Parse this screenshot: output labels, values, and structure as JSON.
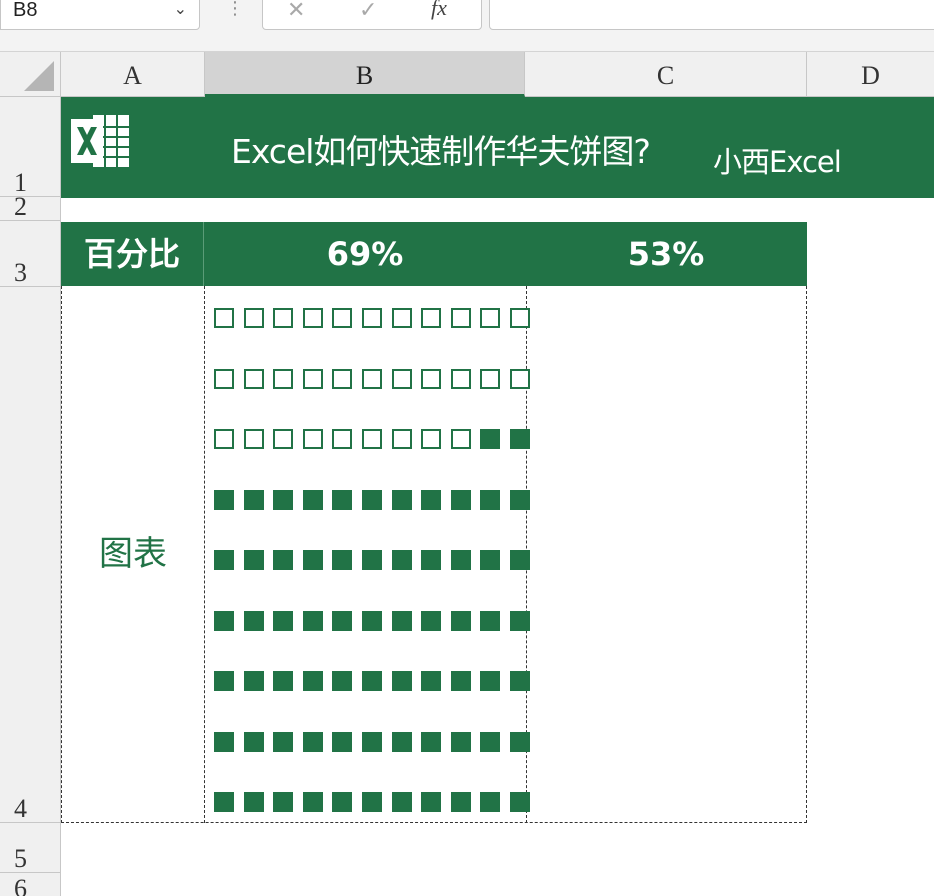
{
  "formula_bar": {
    "name_box": "B8",
    "name_box_arrow": "⌄",
    "separator": "⋮",
    "cancel_icon": "✕",
    "enter_icon": "✓",
    "fx_label": "fx"
  },
  "columns": [
    "A",
    "B",
    "C",
    "D"
  ],
  "rows": [
    "1",
    "2",
    "3",
    "4",
    "5",
    "6"
  ],
  "title_banner": {
    "title": "Excel如何快速制作华夫饼图?",
    "brand": "小西Excel",
    "logo": "excel-logo-icon"
  },
  "table": {
    "header_label": "百分比",
    "percent_b": "69%",
    "percent_c": "53%",
    "chart_label": "图表"
  },
  "waffle": {
    "value": 0.69,
    "rows": 9,
    "cols": 11,
    "filled_color": "#217346",
    "empty_symbol": "□",
    "filled_symbol": "■"
  },
  "colors": {
    "accent": "#217346",
    "header_bg": "#f0f0f0",
    "selected_col": "#d3d3d3"
  }
}
